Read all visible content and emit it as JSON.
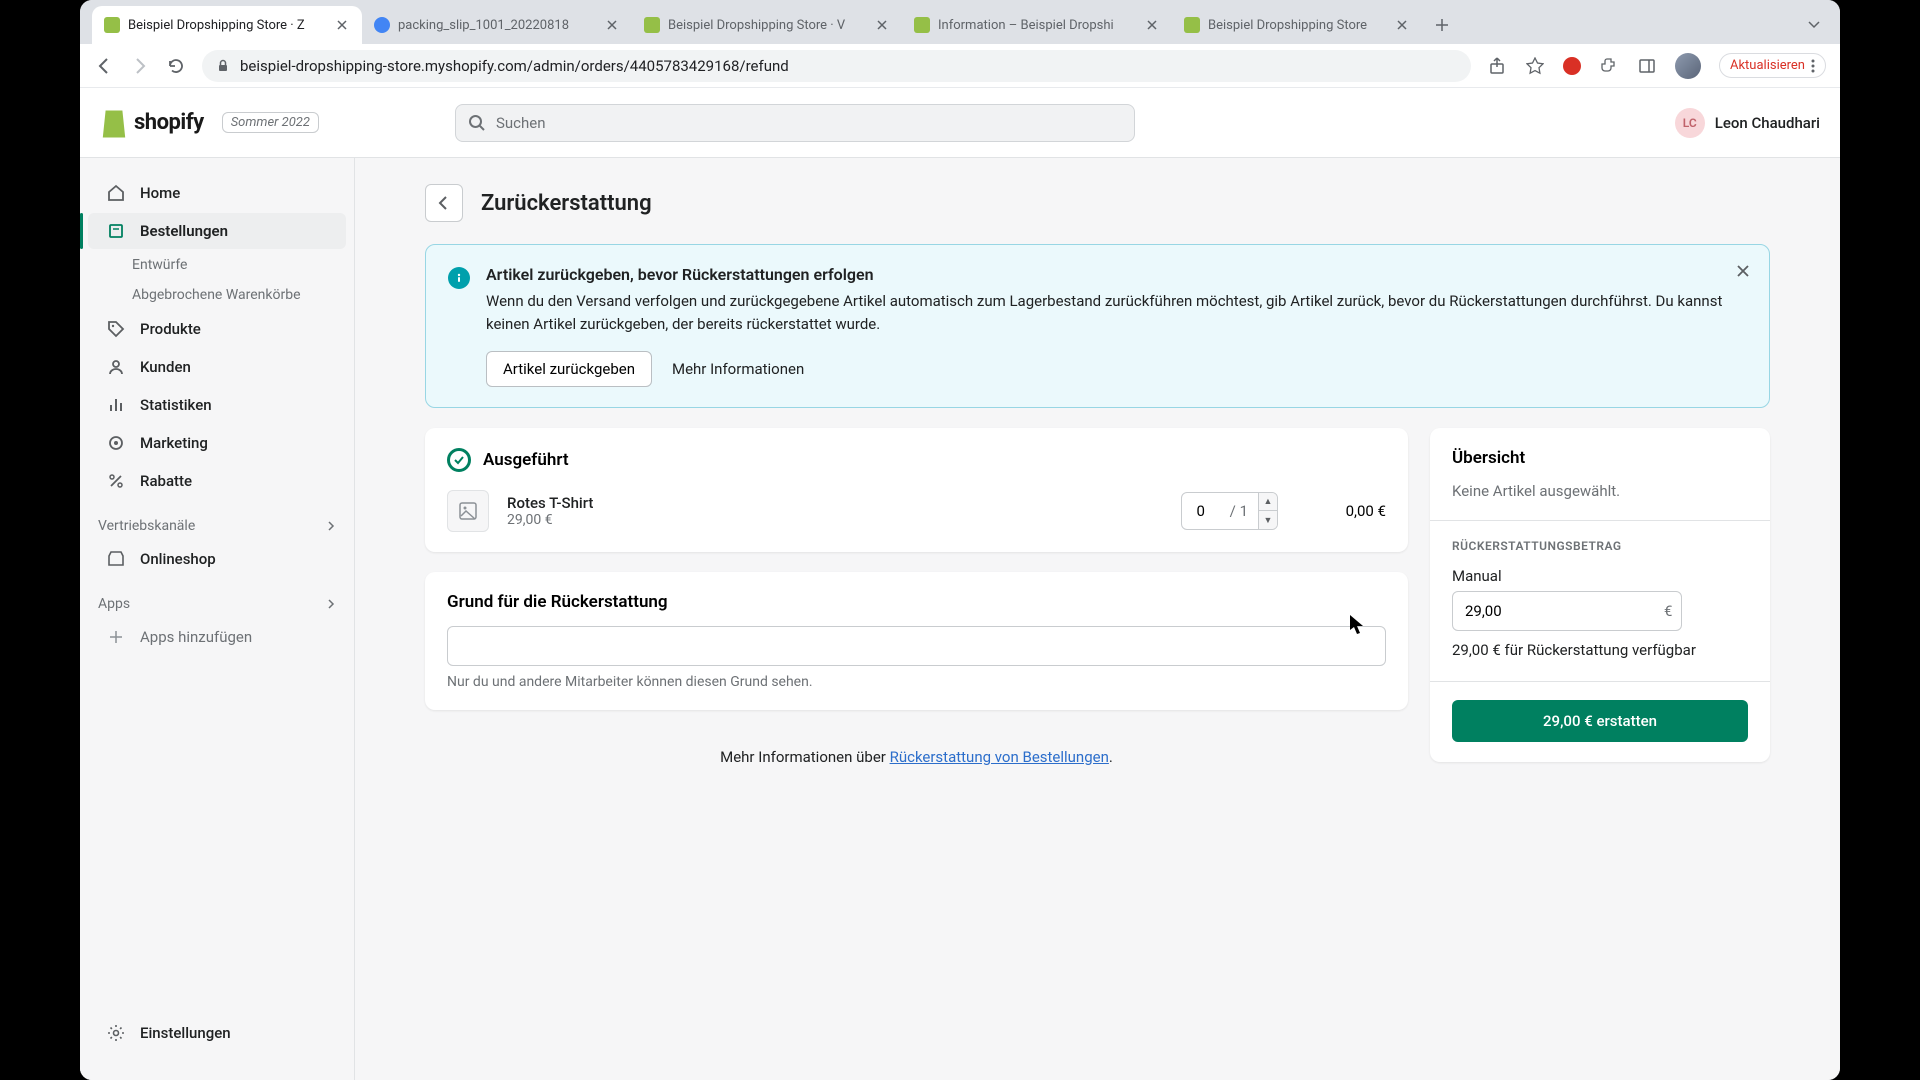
{
  "browser": {
    "tabs": [
      {
        "title": "Beispiel Dropshipping Store · Z",
        "favicon": "#95bf47"
      },
      {
        "title": "packing_slip_1001_20220818",
        "favicon": "#4285f4"
      },
      {
        "title": "Beispiel Dropshipping Store · V",
        "favicon": "#95bf47"
      },
      {
        "title": "Information – Beispiel Dropshi",
        "favicon": "#95bf47"
      },
      {
        "title": "Beispiel Dropshipping Store",
        "favicon": "#95bf47"
      }
    ],
    "url": "beispiel-dropshipping-store.myshopify.com/admin/orders/4405783429168/refund",
    "update_label": "Aktualisieren"
  },
  "header": {
    "brand": "shopify",
    "season": "Sommer 2022",
    "search_placeholder": "Suchen",
    "user_initials": "LC",
    "user_name": "Leon Chaudhari"
  },
  "sidebar": {
    "items": [
      {
        "label": "Home"
      },
      {
        "label": "Bestellungen"
      },
      {
        "label": "Produkte"
      },
      {
        "label": "Kunden"
      },
      {
        "label": "Statistiken"
      },
      {
        "label": "Marketing"
      },
      {
        "label": "Rabatte"
      }
    ],
    "sub_items": [
      {
        "label": "Entwürfe"
      },
      {
        "label": "Abgebrochene Warenkörbe"
      }
    ],
    "channels_label": "Vertriebskanäle",
    "onlineshop": "Onlineshop",
    "apps_label": "Apps",
    "add_apps": "Apps hinzufügen",
    "settings": "Einstellungen"
  },
  "page": {
    "title": "Zurückerstattung"
  },
  "banner": {
    "title": "Artikel zurückgeben, bevor Rückerstattungen erfolgen",
    "text": "Wenn du den Versand verfolgen und zurückgegebene Artikel automatisch zum Lagerbestand zurückführen möchtest, gib Artikel zurück, bevor du Rückerstattungen durchführst. Du kannst keinen Artikel zurückgeben, der bereits rückerstattet wurde.",
    "action_primary": "Artikel zurückgeben",
    "action_secondary": "Mehr Informationen"
  },
  "fulfilled": {
    "title": "Ausgeführt",
    "item_name": "Rotes T-Shirt",
    "item_price": "29,00 €",
    "qty": "0",
    "qty_total": "/ 1",
    "line_total": "0,00 €"
  },
  "reason": {
    "title": "Grund für die Rückerstattung",
    "hint": "Nur du und andere Mitarbeiter können diesen Grund sehen."
  },
  "more_info": {
    "prefix": "Mehr Informationen über ",
    "link": "Rückerstattung von Bestellungen",
    "suffix": "."
  },
  "summary": {
    "title": "Übersicht",
    "no_items": "Keine Artikel ausgewählt.",
    "amount_label": "RÜCKERSTATTUNGSBETRAG",
    "manual_label": "Manual",
    "amount_value": "29,00",
    "currency": "€",
    "available": "29,00 € für Rückerstattung verfügbar",
    "button": "29,00 € erstatten"
  }
}
